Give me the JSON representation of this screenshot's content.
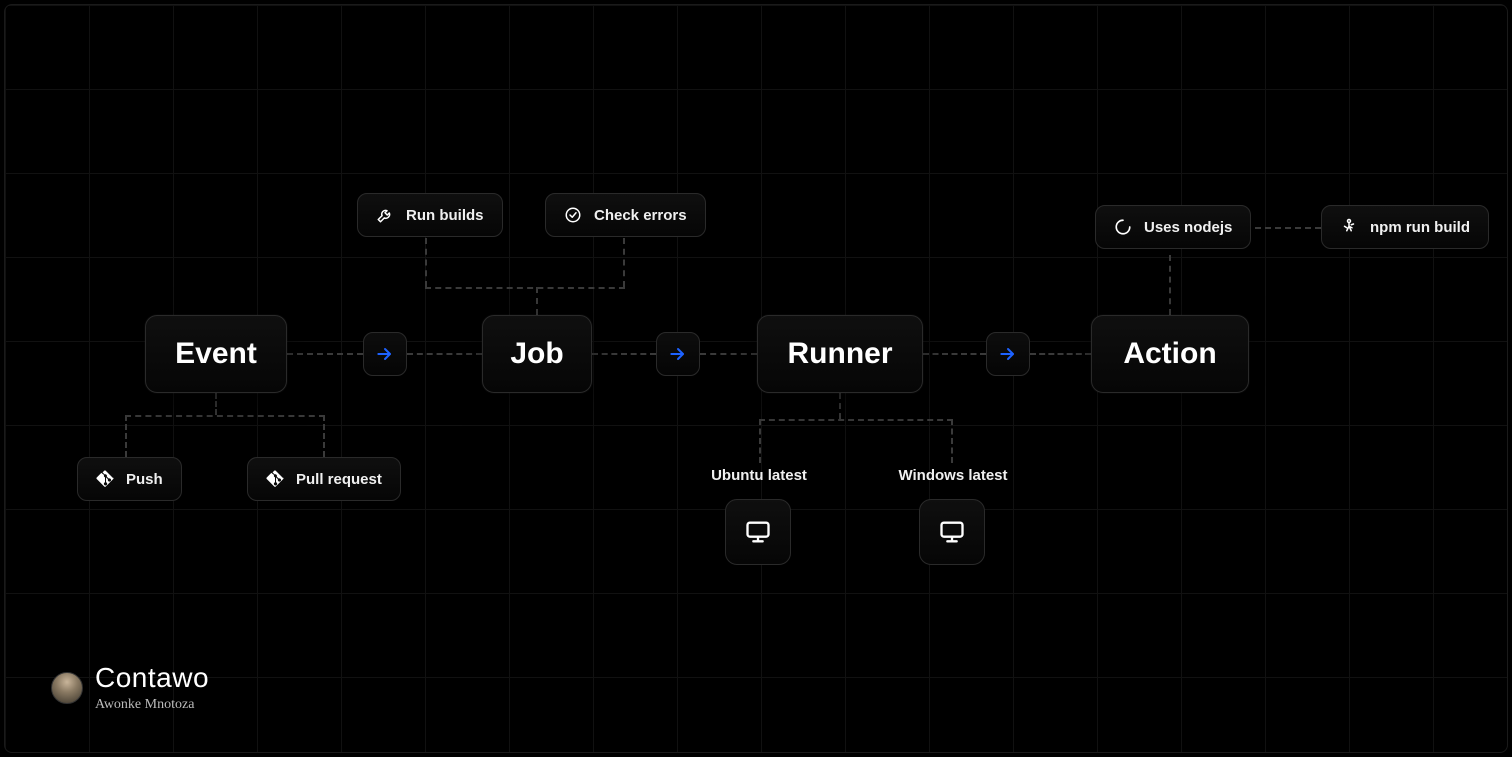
{
  "main_nodes": {
    "event": "Event",
    "job": "Job",
    "runner": "Runner",
    "action": "Action"
  },
  "event_children": {
    "push": "Push",
    "pull_request": "Pull request"
  },
  "job_children": {
    "run_builds": "Run builds",
    "check_errors": "Check errors"
  },
  "runner_children": {
    "ubuntu": "Ubuntu latest",
    "windows": "Windows latest"
  },
  "action_children": {
    "uses_node": "Uses nodejs",
    "npm_build": "npm run build"
  },
  "watermark": {
    "name": "Contawo",
    "subtitle": "Awonke Mnotoza"
  },
  "colors": {
    "arrow": "#1d62ff",
    "border": "#2a2a2a",
    "dash": "#3a3a3a"
  }
}
